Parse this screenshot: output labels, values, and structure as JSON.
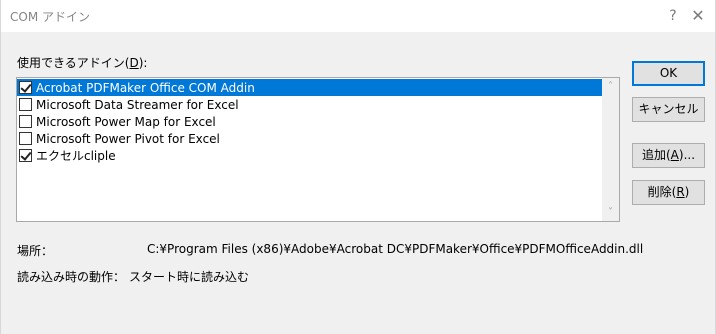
{
  "window": {
    "title": "COM アドイン",
    "help_glyph": "?",
    "close_glyph": "✕"
  },
  "list": {
    "label_prefix": "使用できるアドイン(",
    "label_accel": "D",
    "label_suffix": "):",
    "items": [
      {
        "label": "Acrobat PDFMaker Office COM Addin",
        "checked": true,
        "selected": true
      },
      {
        "label": "Microsoft Data Streamer for Excel",
        "checked": false,
        "selected": false
      },
      {
        "label": "Microsoft Power Map for Excel",
        "checked": false,
        "selected": false
      },
      {
        "label": "Microsoft Power Pivot for Excel",
        "checked": false,
        "selected": false
      },
      {
        "label": "エクセルcliple",
        "checked": true,
        "selected": false
      }
    ],
    "scroll_up_glyph": "˄",
    "scroll_down_glyph": "˅"
  },
  "buttons": {
    "ok": "OK",
    "cancel": "キャンセル",
    "add_prefix": "追加(",
    "add_accel": "A",
    "add_suffix": ")...",
    "remove_prefix": "削除(",
    "remove_accel": "R",
    "remove_suffix": ")"
  },
  "info": {
    "location_label": "場所：",
    "location_value": "C:¥Program Files (x86)¥Adobe¥Acrobat DC¥PDFMaker¥Office¥PDFMOfficeAddin.dll",
    "load_label": "読み込み時の動作：",
    "load_value": "スタート時に読み込む"
  },
  "colors": {
    "selection": "#0078d7",
    "default_button_border": "#0078d7"
  }
}
